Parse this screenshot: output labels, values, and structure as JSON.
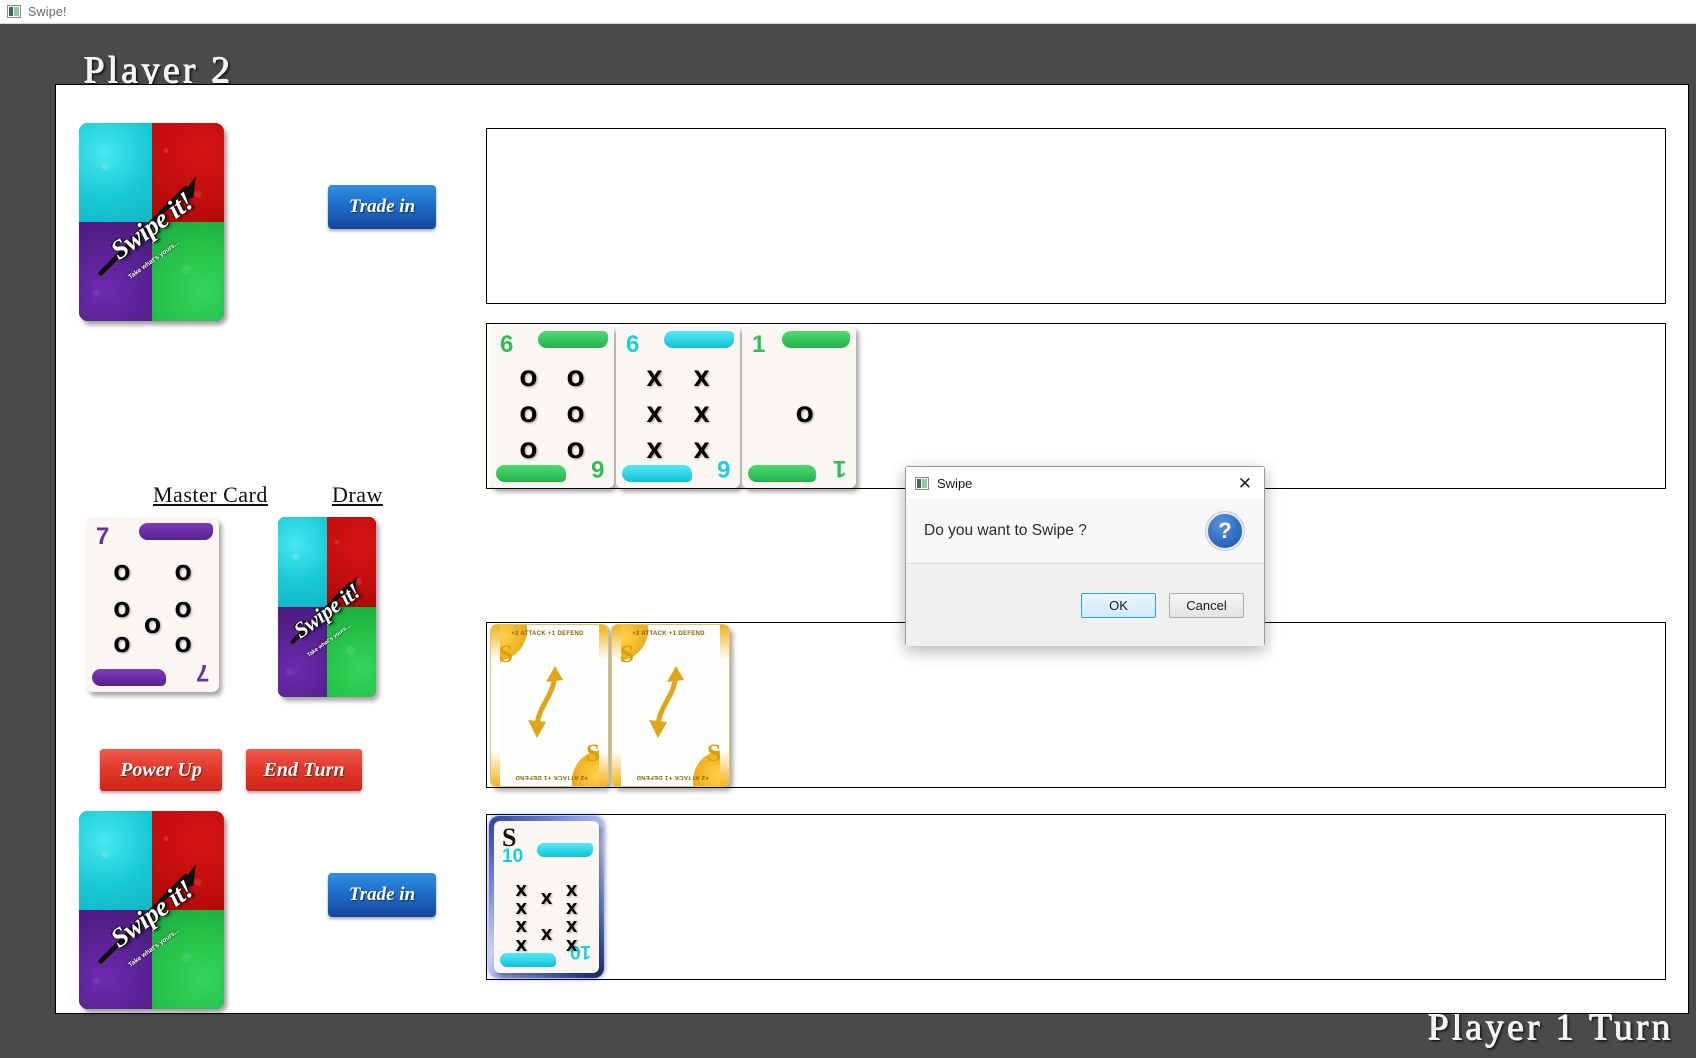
{
  "os_window": {
    "title": "Swipe!",
    "icon": "app-icon"
  },
  "app": {
    "player_banner": "Player 2",
    "turn_banner": "Player 1 Turn"
  },
  "left_panel": {
    "top_deck": {
      "label_swipe": "Swipe it!",
      "label_tagline": "Take what's yours...",
      "trade_in_label": "Trade in"
    },
    "master_card_caption": "Master Card",
    "draw_caption": "Draw",
    "master_card": {
      "value": "7",
      "color": "#6b2fa5",
      "pip_symbol": "O",
      "pip_count": 7
    },
    "draw_card": {
      "label_swipe": "Swipe it!",
      "label_tagline": "Take what's yours..."
    },
    "power_up_label": "Power Up",
    "end_turn_label": "End Turn",
    "bottom_deck": {
      "label_swipe": "Swipe it!",
      "label_tagline": "Take what's yours...",
      "trade_in_label": "Trade in"
    }
  },
  "board": {
    "zone1_cards": [],
    "zone2_cards": [
      {
        "value": "6",
        "color": "#2fbd55",
        "symbol": "O",
        "count": 6
      },
      {
        "value": "6",
        "color": "#18cfe0",
        "symbol": "X",
        "count": 6
      },
      {
        "value": "1",
        "color": "#2fbd55",
        "symbol": "O",
        "count": 1
      }
    ],
    "zone3_cards": [],
    "zone4_cards": [
      {
        "letter": "S",
        "top_label": "+2 ATTACK +1 DEFEND",
        "bottom_label": "+2 ATTACK +1 DEFEND"
      },
      {
        "letter": "S",
        "top_label": "+2 ATTACK +1 DEFEND",
        "bottom_label": "+2 ATTACK +1 DEFEND"
      }
    ],
    "zone5_cards": [
      {
        "letter": "S",
        "value": "10",
        "color": "#18cfe0",
        "symbol": "X",
        "count": 10,
        "selected": true
      }
    ]
  },
  "dialog": {
    "title": "Swipe",
    "icon": "app-icon",
    "close_label": "✕",
    "message": "Do you want to Swipe ?",
    "icon_glyph": "?",
    "ok_label": "OK",
    "cancel_label": "Cancel"
  },
  "colors": {
    "frame_bg": "#4a4a4a",
    "board_bg": "#ffffff",
    "accent_blue": "#1d6fc9",
    "accent_red": "#e33a2c",
    "dialog_accent": "#2f6fc4"
  }
}
